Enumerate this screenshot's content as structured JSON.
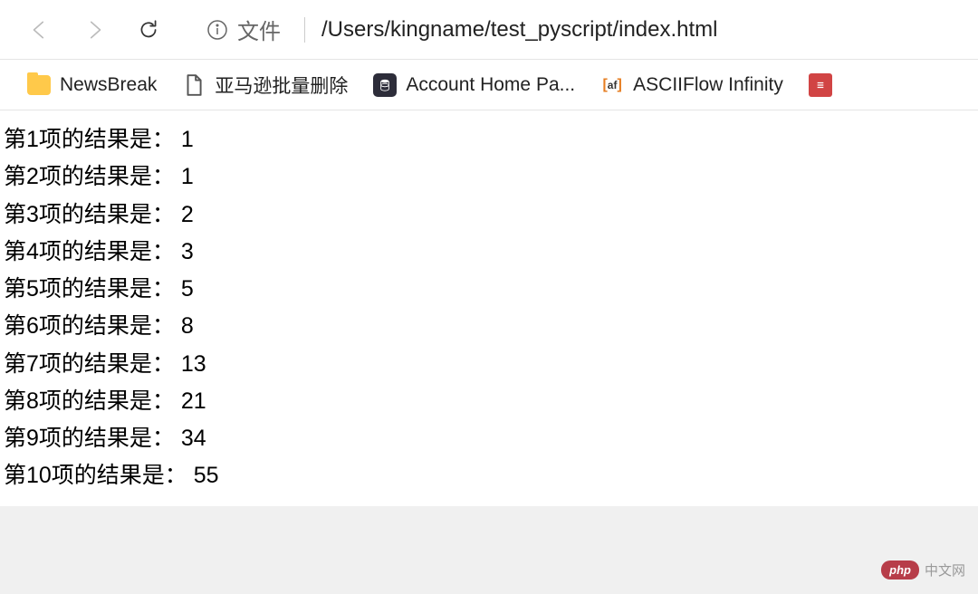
{
  "toolbar": {
    "url_label": "文件",
    "url_path": "/Users/kingname/test_pyscript/index.html"
  },
  "bookmarks": [
    {
      "label": "NewsBreak",
      "icon": "folder"
    },
    {
      "label": "亚马逊批量删除",
      "icon": "file"
    },
    {
      "label": "Account Home Pa...",
      "icon": "database"
    },
    {
      "label": "ASCIIFlow Infinity",
      "icon": "asciiflow"
    },
    {
      "label": "",
      "icon": "red"
    }
  ],
  "content": {
    "results": [
      {
        "index": 1,
        "value": 1
      },
      {
        "index": 2,
        "value": 1
      },
      {
        "index": 3,
        "value": 2
      },
      {
        "index": 4,
        "value": 3
      },
      {
        "index": 5,
        "value": 5
      },
      {
        "index": 6,
        "value": 8
      },
      {
        "index": 7,
        "value": 13
      },
      {
        "index": 8,
        "value": 21
      },
      {
        "index": 9,
        "value": 34
      },
      {
        "index": 10,
        "value": 55
      }
    ],
    "line_prefix": "第",
    "line_middle": "项的结果是：",
    "line_suffix": ""
  },
  "watermark": {
    "logo": "php",
    "text": "中文网"
  }
}
